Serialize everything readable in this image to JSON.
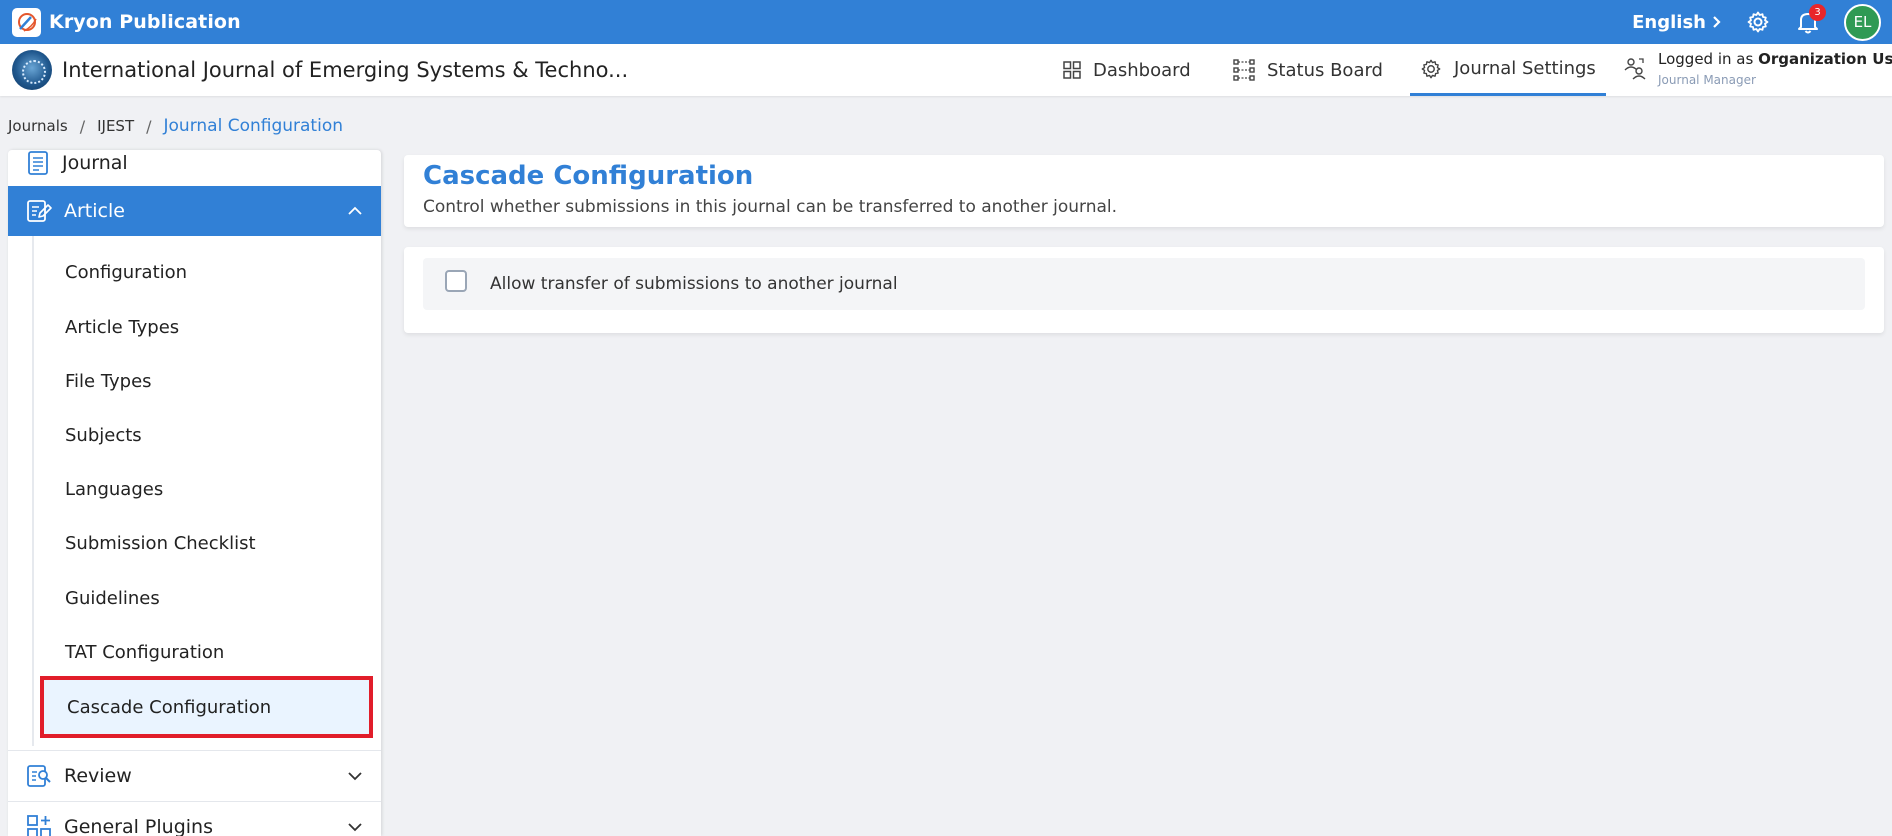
{
  "topbar": {
    "app_name": "Kryon Publication",
    "language": "English",
    "notification_count": "3",
    "avatar_initials": "EL"
  },
  "journal_header": {
    "title": "International Journal of Emerging Systems & Techno...",
    "nav": [
      {
        "label": "Dashboard",
        "icon": "grid-icon"
      },
      {
        "label": "Status Board",
        "icon": "status-board-icon"
      },
      {
        "label": "Journal Settings",
        "icon": "gear-icon",
        "active": true
      }
    ],
    "logged_in_prefix": "Logged in as",
    "user_name": "Organization User",
    "user_role": "Journal Manager"
  },
  "breadcrumb": {
    "items": [
      "Journals",
      "IJEST"
    ],
    "current": "Journal Configuration",
    "separator": "/"
  },
  "sidebar": {
    "journal_label": "Journal",
    "article_label": "Article",
    "article_items": [
      "Configuration",
      "Article Types",
      "File Types",
      "Subjects",
      "Languages",
      "Submission Checklist",
      "Guidelines",
      "TAT Configuration"
    ],
    "active_item": "Cascade Configuration",
    "review_label": "Review",
    "general_plugins_label": "General Plugins"
  },
  "main": {
    "title": "Cascade Configuration",
    "description": "Control whether submissions in this journal can be transferred to another journal.",
    "option_label": "Allow transfer of submissions to another journal",
    "option_checked": false
  },
  "colors": {
    "primary": "#3180d6",
    "highlight_border": "#e11d2a",
    "active_bg": "#eaf4ff",
    "avatar": "#2f9a54",
    "badge": "#e8262b"
  }
}
